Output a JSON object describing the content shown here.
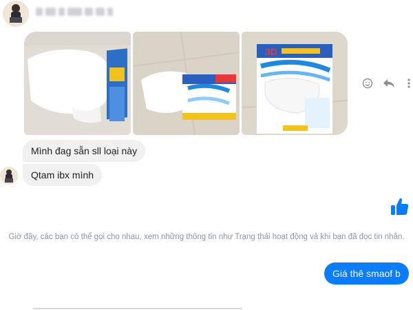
{
  "chat": {
    "contact_name_blurred": true,
    "photos": [
      {
        "name": "photo-mask-1"
      },
      {
        "name": "photo-mask-2"
      },
      {
        "name": "photo-mask-3",
        "box_brand_visible": "3D"
      }
    ],
    "messages_in": [
      {
        "text": "Mình đag sẵn sll loại này"
      },
      {
        "text": "Qtam ibx mình"
      }
    ],
    "notice": "Giờ đây, các bạn có thể gọi cho nhau, xem những thông tin như Trạng thái hoạt động và khi bạn đã đọc tin nhắn.",
    "message_out": "Giá thê smaof b"
  },
  "icons": {
    "react": "smiley-icon",
    "reply": "reply-arrow-icon",
    "more": "more-icon",
    "like": "thumbs-up-icon"
  },
  "colors": {
    "outgoing_bubble": "#0a7cff",
    "incoming_bubble": "#f1f0f0",
    "notice_text": "#8d949e",
    "like": "#0a7cff"
  }
}
